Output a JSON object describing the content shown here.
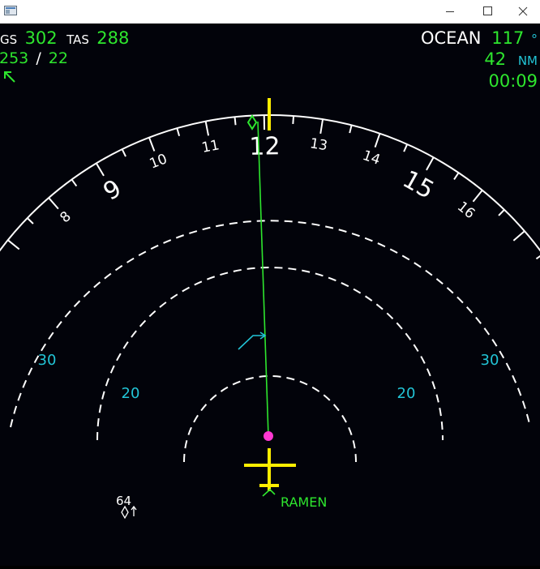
{
  "window": {
    "icons": {
      "app": "app-icon",
      "minimize": "minimize-icon",
      "maximize": "maximize-icon",
      "close": "close-icon"
    }
  },
  "top_left": {
    "gs_label": "GS",
    "gs_value": "302",
    "tas_label": "TAS",
    "tas_value": "288",
    "wind_dir": "253",
    "wind_sep": "/",
    "wind_speed": "22",
    "wind_arrow_icon": "wind-arrow-icon"
  },
  "top_right": {
    "waypoint": "OCEAN",
    "bearing": "117",
    "bearing_unit": "°",
    "distance": "42",
    "distance_unit": "NM",
    "time": "00:09"
  },
  "compass": {
    "labels": [
      "8",
      "9",
      "10",
      "11",
      "12",
      "13",
      "14",
      "15",
      "16"
    ]
  },
  "range_rings": {
    "labels": [
      "30",
      "20",
      "20",
      "30"
    ]
  },
  "traffic": {
    "label": "64"
  },
  "waypoint_label": "RAMEN",
  "colors": {
    "green": "#2ee62e",
    "white": "#ffffff",
    "cyan": "#22c4d6",
    "yellow": "#ffee00",
    "magenta": "#ff38d2",
    "background": "#02030a"
  }
}
